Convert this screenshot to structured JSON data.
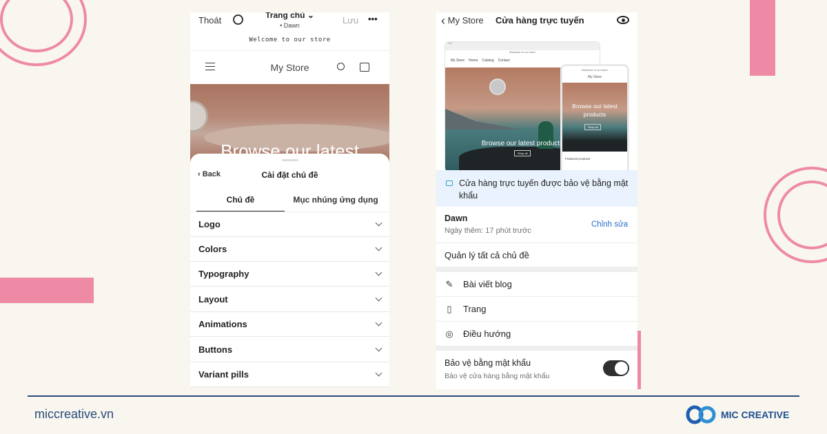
{
  "left_phone": {
    "top_bar": {
      "exit": "Thoát",
      "page": "Trang chủ",
      "theme": "• Dawn",
      "save": "Lưu",
      "more": "•••"
    },
    "announcement": "Welcome to our store",
    "store_name": "My Store",
    "hero_text": "Browse our latest",
    "sheet": {
      "back": "Back",
      "title": "Cài đặt chủ đề",
      "tabs": [
        {
          "label": "Chủ đề",
          "active": true
        },
        {
          "label": "Mục nhúng ứng dụng",
          "active": false
        }
      ],
      "sections": [
        "Logo",
        "Colors",
        "Typography",
        "Layout",
        "Animations",
        "Buttons",
        "Variant pills"
      ]
    }
  },
  "right_phone": {
    "header": {
      "back": "My Store",
      "title": "Cửa hàng trực tuyến"
    },
    "preview": {
      "desktop_announcement": "Welcome to our store",
      "desktop_store": "My Store",
      "desktop_nav": [
        "Home",
        "Catalog",
        "Contact"
      ],
      "desktop_hero": "Browse our latest products",
      "desktop_button": "Shop all",
      "mobile_announcement": "Welcome to our store",
      "mobile_store": "My Store",
      "mobile_hero": "Browse our latest products",
      "mobile_button": "Shop all",
      "mobile_featured": "Featured products"
    },
    "banner": "Cửa hàng trực tuyến được bảo vệ bằng mật khẩu",
    "theme": {
      "name": "Dawn",
      "added": "Ngày thêm: 17 phút trước",
      "edit": "Chỉnh sửa"
    },
    "manage_themes": "Quản lý tất cả chủ đề",
    "menu": [
      {
        "icon": "edit-icon",
        "label": "Bài viết blog"
      },
      {
        "icon": "page-icon",
        "label": "Trang"
      },
      {
        "icon": "compass-icon",
        "label": "Điều hướng"
      }
    ],
    "password": {
      "title": "Bảo vệ bằng mật khẩu",
      "subtitle": "Bảo vệ cửa hàng bằng mật khẩu",
      "enabled": true
    }
  },
  "footer": {
    "website": "miccreative.vn",
    "brand": "MIC CREATIVE"
  },
  "colors": {
    "accent_pink": "#ee8aa5",
    "navy": "#2b4a7a",
    "link_blue": "#2c6ecb",
    "banner_blue": "#eaf3fd"
  }
}
